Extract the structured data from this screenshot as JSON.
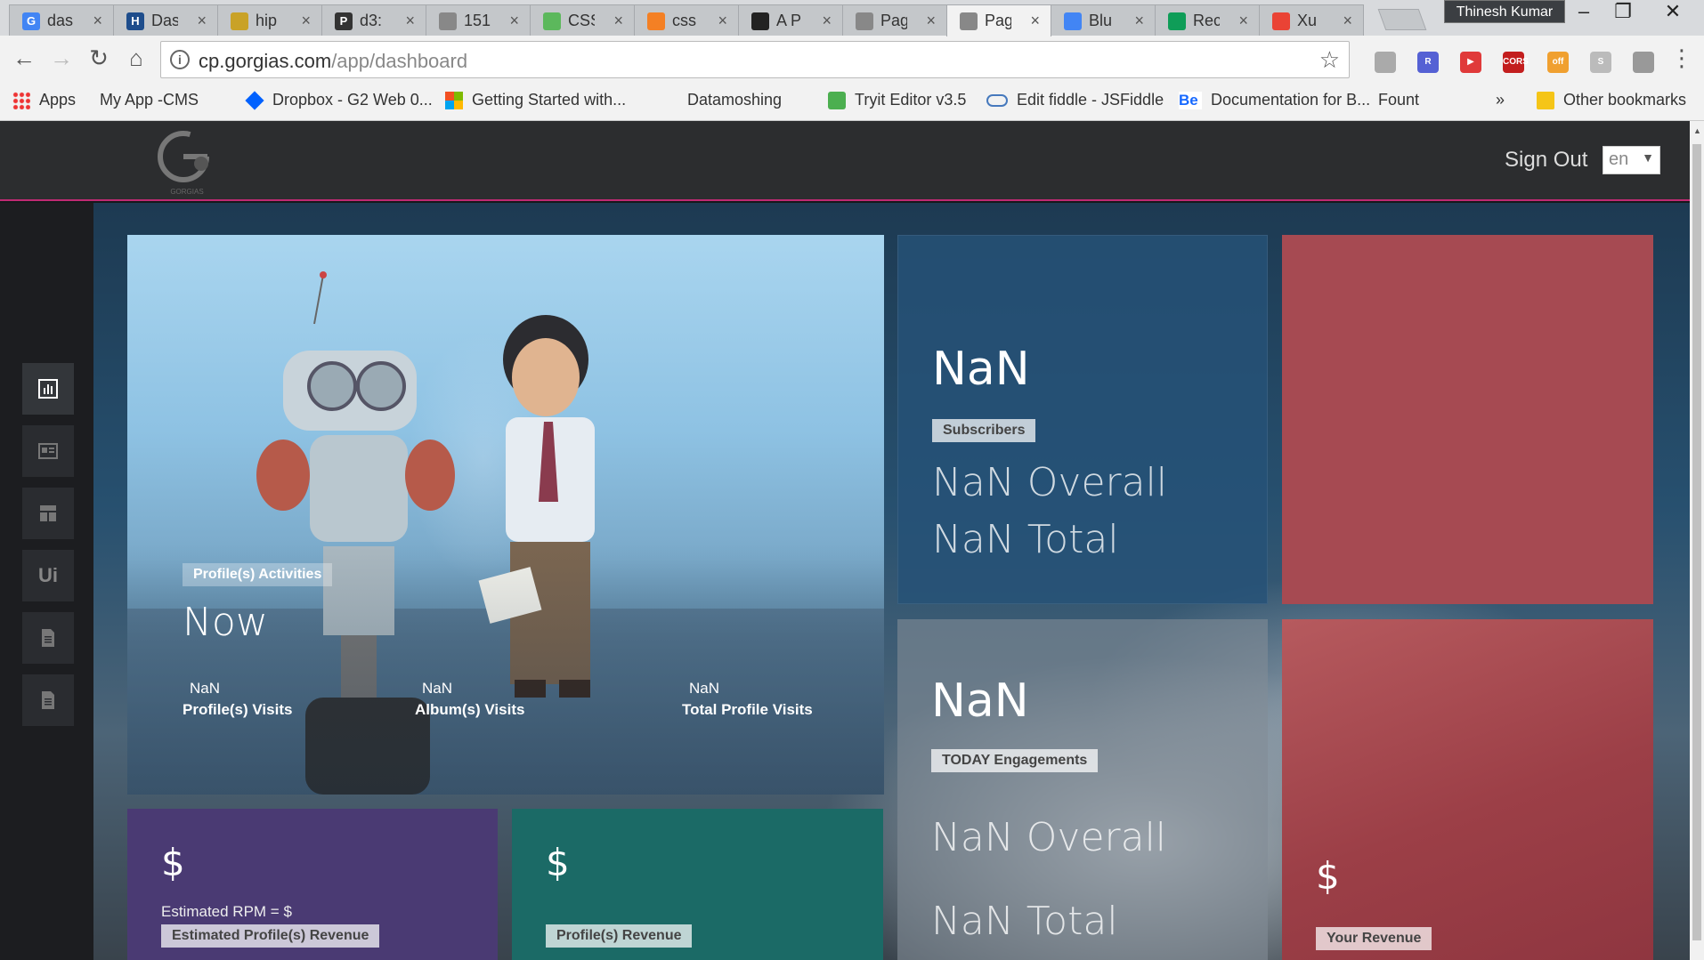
{
  "browser": {
    "tabs": [
      {
        "label": "das",
        "color": "#4285f4",
        "glyph": "G"
      },
      {
        "label": "Das",
        "color": "#1e4d8c",
        "glyph": "H"
      },
      {
        "label": "hip",
        "color": "#c9a227",
        "glyph": ""
      },
      {
        "label": "d3:",
        "color": "#333333",
        "glyph": "P"
      },
      {
        "label": "151",
        "color": "#888888",
        "glyph": ""
      },
      {
        "label": "CSS",
        "color": "#5cb85c",
        "glyph": ""
      },
      {
        "label": "css",
        "color": "#f48024",
        "glyph": ""
      },
      {
        "label": "A P",
        "color": "#222222",
        "glyph": ""
      },
      {
        "label": "Pag",
        "color": "#888888",
        "glyph": ""
      },
      {
        "label": "Pag",
        "color": "#888888",
        "glyph": ""
      },
      {
        "label": "Blu",
        "color": "#4285f4",
        "glyph": ""
      },
      {
        "label": "Rec",
        "color": "#0f9d58",
        "glyph": ""
      },
      {
        "label": "Xu",
        "color": "#ea4335",
        "glyph": ""
      }
    ],
    "active_tab_index": 9,
    "profile_name": "Thinesh Kumar",
    "url_host": "cp.gorgias.com",
    "url_path": "/app/dashboard",
    "bookmarks": [
      {
        "label": "Apps",
        "icon": "apps-icon"
      },
      {
        "label": "My App -CMS",
        "icon": "page-icon"
      },
      {
        "label": "Dropbox - G2 Web 0...",
        "icon": "dropbox-icon"
      },
      {
        "label": "Getting Started with...",
        "icon": "microsoft-icon"
      },
      {
        "label": "",
        "icon": "page-icon"
      },
      {
        "label": "Datamoshing",
        "icon": "page-icon"
      },
      {
        "label": "Tryit Editor v3.5",
        "icon": "w3-icon"
      },
      {
        "label": "Edit fiddle - JSFiddle",
        "icon": "jsfiddle-icon"
      },
      {
        "label": "Documentation for B...",
        "icon": "behance-icon"
      },
      {
        "label": "Fount",
        "icon": "page-icon"
      }
    ],
    "bookmarks_overflow": "»",
    "other_bookmarks": "Other bookmarks"
  },
  "header": {
    "logo_text": "GORGIAS",
    "sign_out": "Sign Out",
    "language": "en"
  },
  "sidebar": {
    "items": [
      {
        "name": "dashboard",
        "icon": "bar-chart-icon"
      },
      {
        "name": "content",
        "icon": "card-icon"
      },
      {
        "name": "layout",
        "icon": "layout-icon"
      },
      {
        "name": "ui",
        "icon": "ui-icon",
        "text": "Ui"
      },
      {
        "name": "docs",
        "icon": "document-icon"
      },
      {
        "name": "pages",
        "icon": "document-icon"
      }
    ]
  },
  "hero": {
    "badge": "Profile(s) Activities",
    "headline": "Now",
    "stats": [
      {
        "value": "NaN",
        "label": "Profile(s) Visits"
      },
      {
        "value": "NaN",
        "label": "Album(s) Visits"
      },
      {
        "value": "NaN",
        "label": "Total Profile Visits"
      }
    ]
  },
  "subscribers": {
    "value": "NaN",
    "badge": "Subscribers",
    "overall": "NaN Overall",
    "total": "NaN Total"
  },
  "engagements": {
    "value": "NaN",
    "badge": "TODAY Engagements",
    "overall": "NaN Overall",
    "total": "NaN Total"
  },
  "profile_revenue_estimate": {
    "currency": "$",
    "rpm": "Estimated RPM = $",
    "badge": "Estimated Profile(s) Revenue"
  },
  "profile_revenue": {
    "currency": "$",
    "badge": "Profile(s) Revenue"
  },
  "your_revenue": {
    "currency": "$",
    "badge": "Your Revenue"
  },
  "colors": {
    "accent": "#c02a73",
    "purple_tile": "#4a3a73",
    "teal_tile": "#1b6a66",
    "red_tile": "#a64a52",
    "blue_tile": "#265278"
  }
}
